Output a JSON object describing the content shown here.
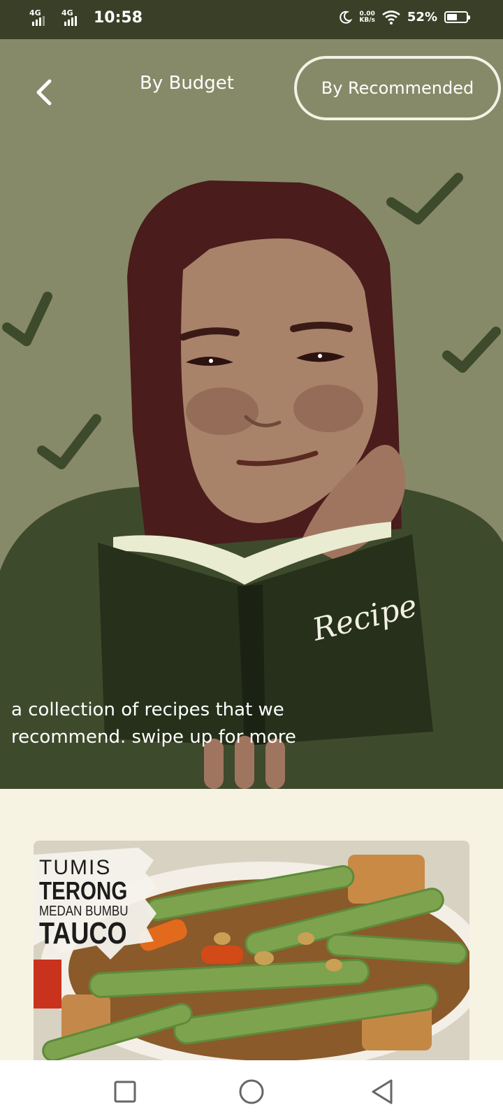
{
  "status_bar": {
    "signal1_label": "4G",
    "signal2_label": "4G",
    "time": "10:58",
    "speed_value": "0.00",
    "speed_unit": "KB/s",
    "battery_percent": "52%",
    "battery_level": 0.52
  },
  "header": {
    "tab_budget": "By Budget",
    "tab_recommended": "By Recommended",
    "back_icon": "chevron-left-icon"
  },
  "hero": {
    "book_label": "Recipe",
    "caption": "a collection of recipes that we recommend. swipe up for more"
  },
  "recipe_card": {
    "title_line1": "TUMIS",
    "title_line2": "TERONG",
    "title_line3": "MEDAN BUMBU",
    "title_line4": "TAUCO"
  },
  "nav_bar": {
    "icons": [
      "square-recents-icon",
      "circle-home-icon",
      "triangle-back-icon"
    ]
  },
  "colors": {
    "status_bar": "#3a4027",
    "hero_background": "#878a68",
    "page_background": "#f7f3e3",
    "sweater": "#3e4a2c",
    "book": "#26301a"
  }
}
